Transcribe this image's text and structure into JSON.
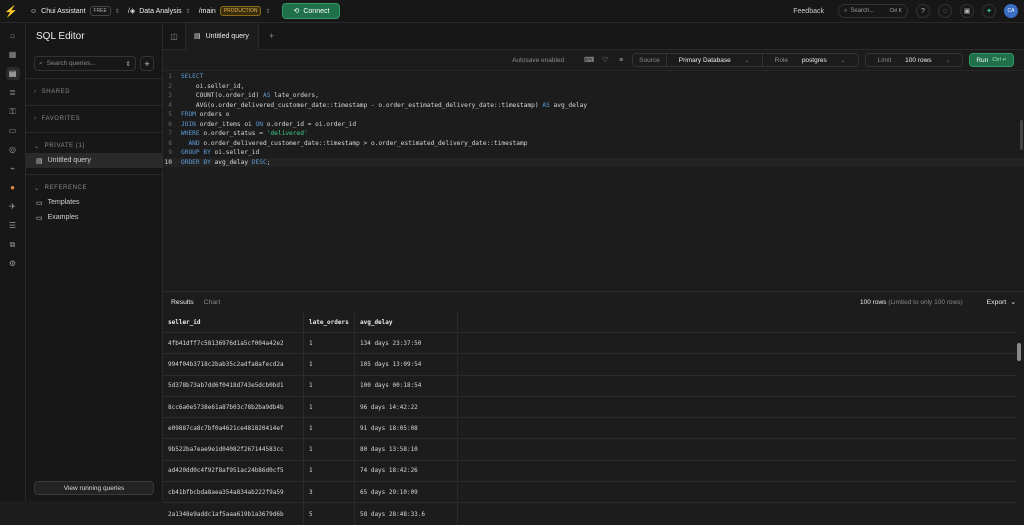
{
  "topbar": {
    "org": "Chui Assistant",
    "org_badge": "FREE",
    "project": "Data Analysis",
    "branch": "main",
    "branch_badge": "PRODUCTION",
    "connect_label": "Connect",
    "feedback_label": "Feedback",
    "search_placeholder": "Search...",
    "search_shortcut": "Ctrl K",
    "avatar_initials": "CA"
  },
  "sidebar": {
    "title": "SQL Editor",
    "search_placeholder": "Search queries...",
    "sections": {
      "shared": "SHARED",
      "favorites": "FAVORITES",
      "private": "PRIVATE (1)",
      "reference": "REFERENCE"
    },
    "private_items": [
      "Untitled query"
    ],
    "reference_items": [
      "Templates",
      "Examples"
    ],
    "running_queries_label": "View running queries"
  },
  "editor": {
    "tab_label": "Untitled query",
    "autosave": "Autosave enabled",
    "source_label": "Source",
    "source_value": "Primary Database",
    "role_label": "Role",
    "role_value": "postgres",
    "limit_label": "Limit",
    "limit_value": "100 rows",
    "run_label": "Run",
    "run_shortcut": "Ctrl ↵",
    "line_numbers": [
      "1",
      "2",
      "3",
      "4",
      "5",
      "6",
      "7",
      "8",
      "9",
      "10"
    ]
  },
  "results": {
    "tabs": [
      "Results",
      "Chart"
    ],
    "row_count": "100 rows",
    "row_count_note": "(Limited to only 100 rows)",
    "export_label": "Export",
    "columns": [
      "seller_id",
      "late_orders",
      "avg_delay"
    ],
    "rows": [
      [
        "4fb41dff7c58136976d1a5cf004a42e2",
        "1",
        "134 days 23:37:50"
      ],
      [
        "994f04b3718c2bab35c2adfa8afecd2a",
        "1",
        "105 days 13:09:54"
      ],
      [
        "5d378b73ab7dd6f0418d743e5dcb0bd1",
        "1",
        "100 days 00:18:54"
      ],
      [
        "8cc6a0e5738e61a87b03c78b2ba9db4b",
        "1",
        "96 days 14:42:22"
      ],
      [
        "e09887ca8c7bf0a4621ce481820414ef",
        "1",
        "91 days 18:05:08"
      ],
      [
        "9b522ba7eae9e1d04082f267144583cc",
        "1",
        "80 days 13:58:10"
      ],
      [
        "ad420dd0c4f92f8af951ac24b86d0cf5",
        "1",
        "74 days 18:42:26"
      ],
      [
        "cb41bfbcbda8aea354a834ab222f9a59",
        "3",
        "65 days 29:10:09"
      ],
      [
        "2a1348e9addc1af5aaa619b1a3679d6b",
        "5",
        "58 days 28:48:33.6"
      ]
    ]
  }
}
